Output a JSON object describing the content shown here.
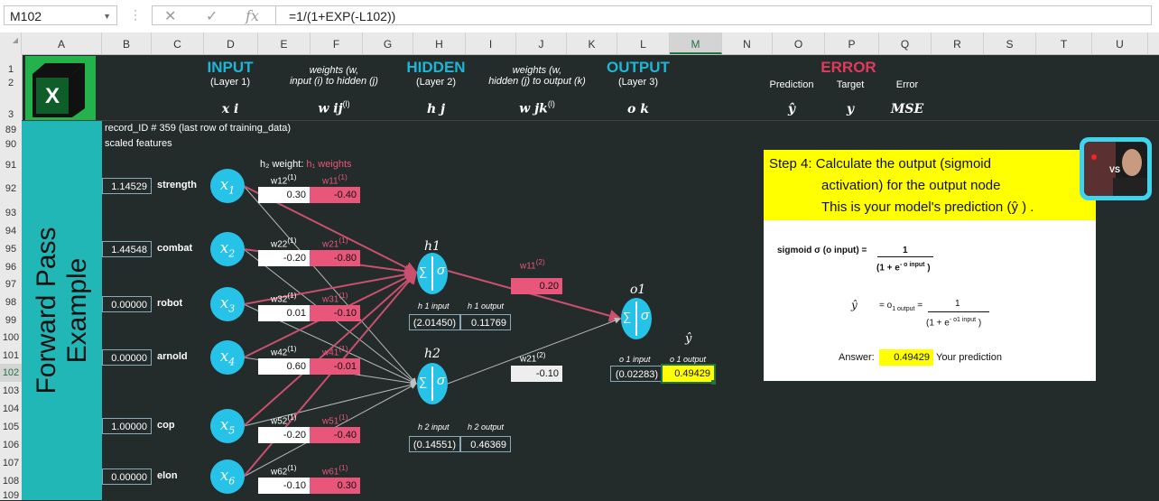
{
  "formula_bar": {
    "name_box": "M102",
    "formula": "=1/(1+EXP(-L102))",
    "fx_label": "fx"
  },
  "columns": [
    "A",
    "B",
    "C",
    "D",
    "E",
    "F",
    "G",
    "H",
    "I",
    "J",
    "K",
    "L",
    "M",
    "N",
    "O",
    "P",
    "Q",
    "R",
    "S",
    "T",
    "U"
  ],
  "rows": [
    "1",
    "2",
    "3",
    "89",
    "90",
    "91",
    "92",
    "93",
    "94",
    "95",
    "96",
    "97",
    "98",
    "99",
    "100",
    "101",
    "102",
    "103",
    "104",
    "105",
    "106",
    "107",
    "108",
    "109"
  ],
  "selected_cell": {
    "column": "M",
    "row": "102"
  },
  "sheet_title": "Forward Pass Example",
  "headers": {
    "input": {
      "title": "INPUT",
      "sub": "(Layer 1)",
      "var": "x i"
    },
    "w_ij": {
      "line1": "weights (w,",
      "line2": "input (i) to hidden (j)",
      "var": "w ij",
      "sup": "(l)"
    },
    "hidden": {
      "title": "HIDDEN",
      "sub": "(Layer 2)",
      "var": "h j"
    },
    "w_jk": {
      "line1": "weights (w,",
      "line2": "hidden (j) to output (k)",
      "var": "w jk",
      "sup": "(l)"
    },
    "output": {
      "title": "OUTPUT",
      "sub": "(Layer 3)",
      "var": "o k"
    },
    "error": {
      "title": "ERROR",
      "prediction": "Prediction",
      "target": "Target",
      "err": "Error",
      "var_pred": "ŷ",
      "var_target": "y",
      "var_err": "MSE"
    }
  },
  "notes": {
    "record": "record_ID # 359 (last row of training_data)",
    "scaled": "scaled features",
    "weights_header_white": "h₂ weight:",
    "weights_header_pink": "h₁ weights"
  },
  "inputs": [
    {
      "name": "strength",
      "value": "1.14529",
      "node": "x1",
      "w2_label": "w12",
      "w1_label": "w11",
      "w2": "0.30",
      "w1": "-0.40"
    },
    {
      "name": "combat",
      "value": "1.44548",
      "node": "x2",
      "w2_label": "w22",
      "w1_label": "w21",
      "w2": "-0.20",
      "w1": "-0.80"
    },
    {
      "name": "robot",
      "value": "0.00000",
      "node": "x3",
      "w2_label": "w32",
      "w1_label": "w31",
      "w2": "0.01",
      "w1": "-0.10"
    },
    {
      "name": "arnold",
      "value": "0.00000",
      "node": "x4",
      "w2_label": "w42",
      "w1_label": "w41",
      "w2": "0.60",
      "w1": "-0.01"
    },
    {
      "name": "cop",
      "value": "1.00000",
      "node": "x5",
      "w2_label": "w52",
      "w1_label": "w51",
      "w2": "-0.20",
      "w1": "-0.40"
    },
    {
      "name": "elon",
      "value": "0.00000",
      "node": "x6",
      "w2_label": "w62",
      "w1_label": "w61",
      "w2": "-0.10",
      "w1": "0.30"
    }
  ],
  "sup1": "(1)",
  "sup2": "(2)",
  "hidden_nodes": {
    "h1": {
      "label": "h1",
      "input_label": "h 1 input",
      "output_label": "h 1 output",
      "input": "(2.01450)",
      "output": "0.11769"
    },
    "h2": {
      "label": "h2",
      "input_label": "h 2 input",
      "output_label": "h 2 output",
      "input": "(0.14551)",
      "output": "0.46369"
    }
  },
  "hidden_weights": {
    "w11_label": "w11",
    "w11": "0.20",
    "w21_label": "w21",
    "w21": "-0.10"
  },
  "output_node": {
    "label": "o1",
    "input_label": "o 1 input",
    "output_label": "o 1 output",
    "input": "(0.02283)",
    "output": "0.49429",
    "yhat": "ŷ"
  },
  "step": {
    "line1": "Step 4:  Calculate the output (sigmoid",
    "line2": "activation) for the output node",
    "line3": "This is your  model's prediction (ŷ ) ."
  },
  "formula_panel": {
    "sigmoid_lhs": "sigmoid σ (o input) =",
    "num": "1",
    "den": "(1 + e",
    "den_exp": "- o input",
    "den_close": ")",
    "yhat_lhs": "ŷ",
    "yhat_eq": "= o",
    "yhat_sub": "1 output",
    "yhat_eq2": "=",
    "num2": "1",
    "den2": "(1 + e",
    "den2_exp": "- o1 input",
    "den2_close": ")",
    "answer_label": "Answer:",
    "answer_value": "0.49429",
    "answer_note": "Your prediction"
  },
  "avatar_text": "VS",
  "colors": {
    "teal": "#22b7b7",
    "pink": "#e8567a",
    "yellow": "#ffff00",
    "node": "#27c2e8",
    "background": "#232b2b",
    "red_header": "#e03a5c"
  }
}
